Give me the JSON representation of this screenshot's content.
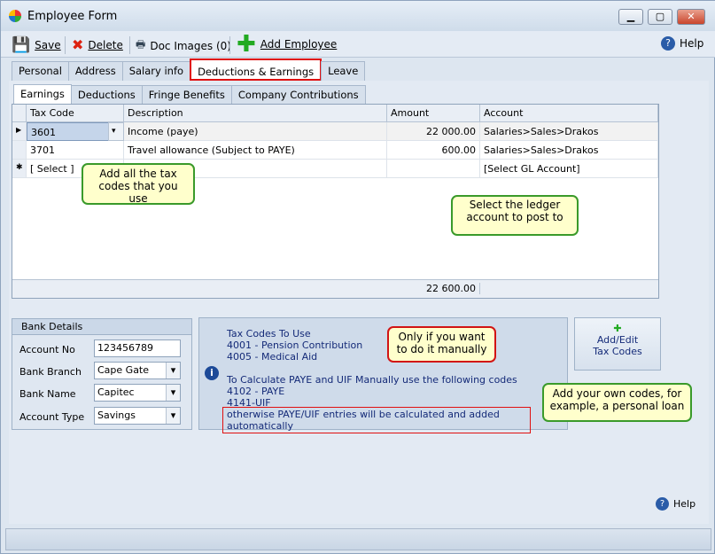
{
  "window": {
    "title": "Employee Form",
    "controls": [
      "minimize",
      "maximize",
      "close"
    ]
  },
  "toolbar": {
    "save": "Save",
    "delete": "Delete",
    "doc_images": "Doc Images (0)",
    "add_employee": "Add Employee",
    "help": "Help"
  },
  "tabs": [
    "Personal",
    "Address",
    "Salary info",
    "Deductions & Earnings",
    "Leave"
  ],
  "active_tab": "Deductions & Earnings",
  "subtabs": [
    "Earnings",
    "Deductions",
    "Fringe Benefits",
    "Company Contributions"
  ],
  "active_subtab": "Earnings",
  "grid": {
    "columns": [
      "Tax Code",
      "Description",
      "Amount",
      "Account"
    ],
    "rows": [
      {
        "code": "3601",
        "description": "Income (paye)",
        "amount": "22 000.00",
        "account": "Salaries>Sales>Drakos"
      },
      {
        "code": "3701",
        "description": "Travel allowance (Subject to PAYE)",
        "amount": "600.00",
        "account": "Salaries>Sales>Drakos"
      }
    ],
    "new_row": {
      "code": "[ Select ]",
      "account": "[Select GL Account]"
    },
    "total": "22 600.00"
  },
  "callouts": {
    "tax_codes": "Add all the tax codes that you use",
    "ledger": "Select the ledger account to post to",
    "manual": "Only if you want to do it manually",
    "own_codes": "Add your own codes, for example, a personal loan"
  },
  "bank": {
    "title": "Bank Details",
    "account_no_label": "Account No",
    "account_no": "123456789",
    "branch_label": "Bank Branch",
    "branch": "Cape Gate",
    "name_label": "Bank Name",
    "name": "Capitec",
    "type_label": "Account Type",
    "type": "Savings"
  },
  "info": {
    "lines": [
      "Tax Codes To Use",
      "4001 - Pension Contribution",
      "4005 - Medical Aid",
      "",
      "To Calculate PAYE and UIF Manually use the following codes",
      "4102 - PAYE",
      "4141-UIF"
    ],
    "note": "otherwise PAYE/UIF entries will be calculated and added automatically"
  },
  "add_edit": {
    "line1": "Add/Edit",
    "line2": "Tax Codes"
  },
  "help_bottom": "Help",
  "colors": {
    "highlight": "#e01010",
    "callout_green": "#3a9a2a",
    "info_text": "#142a78"
  }
}
